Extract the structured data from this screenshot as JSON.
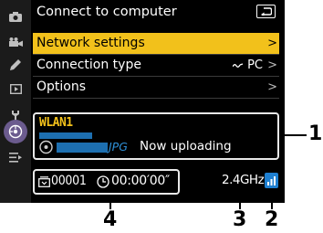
{
  "screen": {
    "title": "Connect to computer",
    "menu": [
      {
        "label": "Network settings",
        "value": "",
        "arrow": ">"
      },
      {
        "label": "Connection type",
        "value": "PC",
        "arrow": ">"
      },
      {
        "label": "Options",
        "value": "",
        "arrow": ">"
      }
    ],
    "status": {
      "ssid": "WLAN1",
      "file_ext": "JPG",
      "upload_status": "Now uploading"
    },
    "bottom": {
      "count": "00001",
      "time": "00:00′00″",
      "band": "2.4GHz"
    }
  },
  "callouts": [
    "1",
    "2",
    "3",
    "4"
  ],
  "colors": {
    "highlight": "#f2c11b",
    "blue": "#1e7fd0",
    "rail_active": "#6b5b8e"
  },
  "icons": [
    "camera-icon",
    "video-icon",
    "pencil-icon",
    "playback-icon",
    "wrench-icon",
    "network-icon",
    "custom-menu-icon",
    "back-icon",
    "signal-strength-icon",
    "clock-icon",
    "counter-icon"
  ]
}
